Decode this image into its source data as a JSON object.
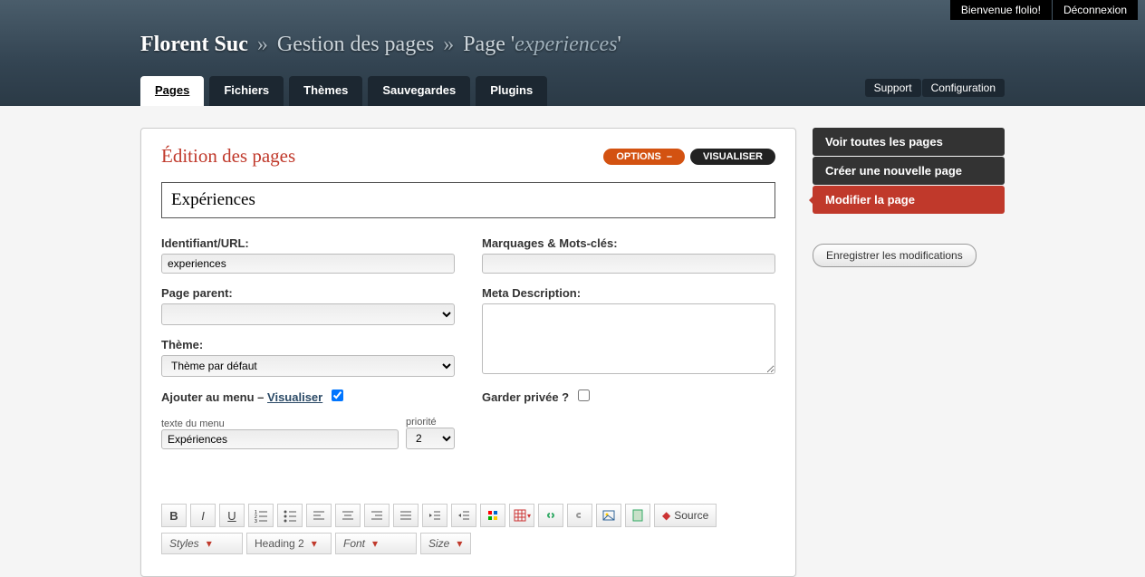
{
  "top": {
    "welcome": "Bienvenue flolio!",
    "logout": "Déconnexion"
  },
  "breadcrumb": {
    "site": "Florent Suc",
    "section": "Gestion des pages",
    "page_prefix": "Page '",
    "slug": "experiences",
    "page_suffix": "'"
  },
  "tabs": [
    "Pages",
    "Fichiers",
    "Thèmes",
    "Sauvegardes",
    "Plugins"
  ],
  "aux": {
    "support": "Support",
    "config": "Configuration"
  },
  "panel": {
    "title": "Édition des pages",
    "options": "OPTIONS",
    "visualiser": "VISUALISER",
    "page_title": "Expériences",
    "left": {
      "url_label": "Identifiant/URL:",
      "url_value": "experiences",
      "parent_label": "Page parent:",
      "parent_value": "",
      "theme_label": "Thème:",
      "theme_value": "Thème par défaut",
      "menu_label_pre": "Ajouter au menu – ",
      "menu_link": "Visualiser",
      "menu_text_label": "texte du menu",
      "menu_text_value": "Expériences",
      "priority_label": "priorité",
      "priority_value": "2"
    },
    "right": {
      "tags_label": "Marquages & Mots-clés:",
      "tags_value": "",
      "meta_label": "Meta Description:",
      "meta_value": "",
      "private_label": "Garder privée ?"
    },
    "editor": {
      "source": "Source",
      "sel_styles": "Styles",
      "sel_heading": "Heading 2",
      "sel_font": "Font",
      "sel_size": "Size"
    }
  },
  "sidebar": {
    "items": [
      {
        "label": "Voir toutes les pages",
        "active": false
      },
      {
        "label": "Créer une nouvelle page",
        "active": false
      },
      {
        "label": "Modifier la page",
        "active": true
      }
    ],
    "save": "Enregistrer les modifications"
  }
}
